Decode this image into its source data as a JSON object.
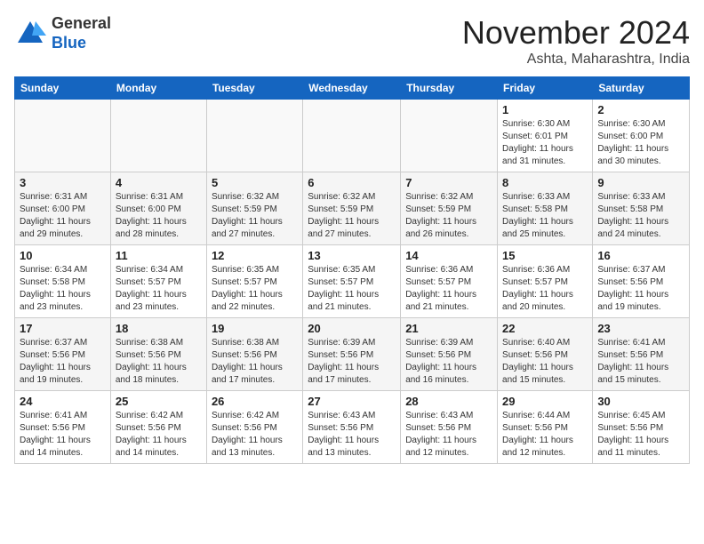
{
  "logo": {
    "general": "General",
    "blue": "Blue"
  },
  "title": "November 2024",
  "subtitle": "Ashta, Maharashtra, India",
  "days_of_week": [
    "Sunday",
    "Monday",
    "Tuesday",
    "Wednesday",
    "Thursday",
    "Friday",
    "Saturday"
  ],
  "weeks": [
    [
      {
        "day": "",
        "info": ""
      },
      {
        "day": "",
        "info": ""
      },
      {
        "day": "",
        "info": ""
      },
      {
        "day": "",
        "info": ""
      },
      {
        "day": "",
        "info": ""
      },
      {
        "day": "1",
        "info": "Sunrise: 6:30 AM\nSunset: 6:01 PM\nDaylight: 11 hours and 31 minutes."
      },
      {
        "day": "2",
        "info": "Sunrise: 6:30 AM\nSunset: 6:00 PM\nDaylight: 11 hours and 30 minutes."
      }
    ],
    [
      {
        "day": "3",
        "info": "Sunrise: 6:31 AM\nSunset: 6:00 PM\nDaylight: 11 hours and 29 minutes."
      },
      {
        "day": "4",
        "info": "Sunrise: 6:31 AM\nSunset: 6:00 PM\nDaylight: 11 hours and 28 minutes."
      },
      {
        "day": "5",
        "info": "Sunrise: 6:32 AM\nSunset: 5:59 PM\nDaylight: 11 hours and 27 minutes."
      },
      {
        "day": "6",
        "info": "Sunrise: 6:32 AM\nSunset: 5:59 PM\nDaylight: 11 hours and 27 minutes."
      },
      {
        "day": "7",
        "info": "Sunrise: 6:32 AM\nSunset: 5:59 PM\nDaylight: 11 hours and 26 minutes."
      },
      {
        "day": "8",
        "info": "Sunrise: 6:33 AM\nSunset: 5:58 PM\nDaylight: 11 hours and 25 minutes."
      },
      {
        "day": "9",
        "info": "Sunrise: 6:33 AM\nSunset: 5:58 PM\nDaylight: 11 hours and 24 minutes."
      }
    ],
    [
      {
        "day": "10",
        "info": "Sunrise: 6:34 AM\nSunset: 5:58 PM\nDaylight: 11 hours and 23 minutes."
      },
      {
        "day": "11",
        "info": "Sunrise: 6:34 AM\nSunset: 5:57 PM\nDaylight: 11 hours and 23 minutes."
      },
      {
        "day": "12",
        "info": "Sunrise: 6:35 AM\nSunset: 5:57 PM\nDaylight: 11 hours and 22 minutes."
      },
      {
        "day": "13",
        "info": "Sunrise: 6:35 AM\nSunset: 5:57 PM\nDaylight: 11 hours and 21 minutes."
      },
      {
        "day": "14",
        "info": "Sunrise: 6:36 AM\nSunset: 5:57 PM\nDaylight: 11 hours and 21 minutes."
      },
      {
        "day": "15",
        "info": "Sunrise: 6:36 AM\nSunset: 5:57 PM\nDaylight: 11 hours and 20 minutes."
      },
      {
        "day": "16",
        "info": "Sunrise: 6:37 AM\nSunset: 5:56 PM\nDaylight: 11 hours and 19 minutes."
      }
    ],
    [
      {
        "day": "17",
        "info": "Sunrise: 6:37 AM\nSunset: 5:56 PM\nDaylight: 11 hours and 19 minutes."
      },
      {
        "day": "18",
        "info": "Sunrise: 6:38 AM\nSunset: 5:56 PM\nDaylight: 11 hours and 18 minutes."
      },
      {
        "day": "19",
        "info": "Sunrise: 6:38 AM\nSunset: 5:56 PM\nDaylight: 11 hours and 17 minutes."
      },
      {
        "day": "20",
        "info": "Sunrise: 6:39 AM\nSunset: 5:56 PM\nDaylight: 11 hours and 17 minutes."
      },
      {
        "day": "21",
        "info": "Sunrise: 6:39 AM\nSunset: 5:56 PM\nDaylight: 11 hours and 16 minutes."
      },
      {
        "day": "22",
        "info": "Sunrise: 6:40 AM\nSunset: 5:56 PM\nDaylight: 11 hours and 15 minutes."
      },
      {
        "day": "23",
        "info": "Sunrise: 6:41 AM\nSunset: 5:56 PM\nDaylight: 11 hours and 15 minutes."
      }
    ],
    [
      {
        "day": "24",
        "info": "Sunrise: 6:41 AM\nSunset: 5:56 PM\nDaylight: 11 hours and 14 minutes."
      },
      {
        "day": "25",
        "info": "Sunrise: 6:42 AM\nSunset: 5:56 PM\nDaylight: 11 hours and 14 minutes."
      },
      {
        "day": "26",
        "info": "Sunrise: 6:42 AM\nSunset: 5:56 PM\nDaylight: 11 hours and 13 minutes."
      },
      {
        "day": "27",
        "info": "Sunrise: 6:43 AM\nSunset: 5:56 PM\nDaylight: 11 hours and 13 minutes."
      },
      {
        "day": "28",
        "info": "Sunrise: 6:43 AM\nSunset: 5:56 PM\nDaylight: 11 hours and 12 minutes."
      },
      {
        "day": "29",
        "info": "Sunrise: 6:44 AM\nSunset: 5:56 PM\nDaylight: 11 hours and 12 minutes."
      },
      {
        "day": "30",
        "info": "Sunrise: 6:45 AM\nSunset: 5:56 PM\nDaylight: 11 hours and 11 minutes."
      }
    ]
  ]
}
